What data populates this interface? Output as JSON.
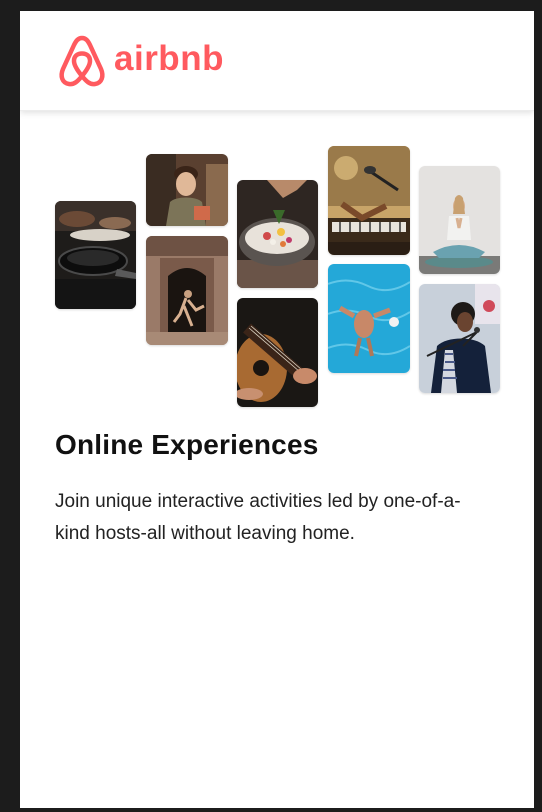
{
  "brand": {
    "name": "airbnb",
    "color": "#ff5a5f"
  },
  "hero": {
    "photos": [
      {
        "subject": "cooking-pans-photo"
      },
      {
        "subject": "smiling-host-photo"
      },
      {
        "subject": "dancer-doorway-photo"
      },
      {
        "subject": "food-bowl-photo"
      },
      {
        "subject": "guitar-player-photo"
      },
      {
        "subject": "keyboard-musician-photo"
      },
      {
        "subject": "swimmer-pool-photo"
      },
      {
        "subject": "meditation-photo"
      },
      {
        "subject": "singer-microphone-photo"
      }
    ]
  },
  "content": {
    "title": "Online Experiences",
    "description": "Join unique interactive activities led by one-of-a-kind hosts-all without leaving home."
  }
}
